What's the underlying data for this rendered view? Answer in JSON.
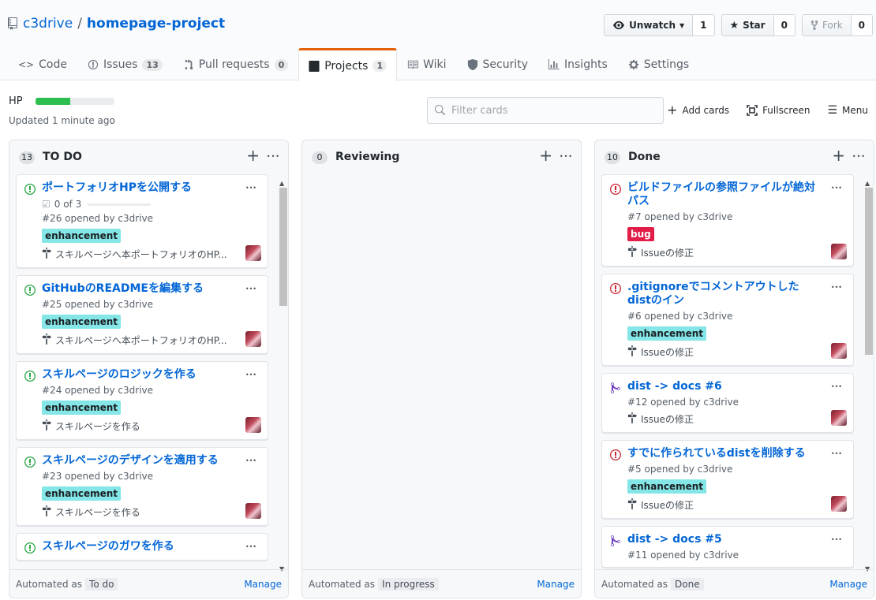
{
  "repo": {
    "owner": "c3drive",
    "separator": "/",
    "name": "homepage-project"
  },
  "actions": {
    "watch": {
      "label": "Unwatch",
      "count": "1"
    },
    "star": {
      "label": "Star",
      "count": "0"
    },
    "fork": {
      "label": "Fork",
      "count": "0"
    }
  },
  "tabs": [
    {
      "label": "Code",
      "counter": "",
      "icon": "code-icon"
    },
    {
      "label": "Issues",
      "counter": "13",
      "icon": "issue-icon"
    },
    {
      "label": "Pull requests",
      "counter": "0",
      "icon": "pull-request-icon"
    },
    {
      "label": "Projects",
      "counter": "1",
      "icon": "project-icon",
      "selected": true
    },
    {
      "label": "Wiki",
      "counter": "",
      "icon": "book-icon"
    },
    {
      "label": "Security",
      "counter": "",
      "icon": "shield-icon"
    },
    {
      "label": "Insights",
      "counter": "",
      "icon": "graph-icon"
    },
    {
      "label": "Settings",
      "counter": "",
      "icon": "gear-icon"
    }
  ],
  "project": {
    "name": "HP",
    "progress": 0.44,
    "updated": "Updated 1 minute ago",
    "filter_placeholder": "Filter cards",
    "add_cards": "Add cards",
    "fullscreen": "Fullscreen",
    "menu": "Menu"
  },
  "columns": [
    {
      "name": "TO DO",
      "count": "13",
      "automated_prefix": "Automated as",
      "automated_as": "To do",
      "manage": "Manage",
      "cards": [
        {
          "type": "issue-open",
          "title": "ポートフォリオHPを公開する",
          "checklist": "0 of 3",
          "meta": "#26 opened by c3drive",
          "label": "enhancement",
          "milestone": "スキルページへ本ポートフォリオのHP..."
        },
        {
          "type": "issue-open",
          "title": "GitHubのREADMEを編集する",
          "meta": "#25 opened by c3drive",
          "label": "enhancement",
          "milestone": "スキルページへ本ポートフォリオのHP..."
        },
        {
          "type": "issue-open",
          "title": "スキルページのロジックを作る",
          "meta": "#24 opened by c3drive",
          "label": "enhancement",
          "milestone": "スキルページを作る"
        },
        {
          "type": "issue-open",
          "title": "スキルページのデザインを適用する",
          "meta": "#23 opened by c3drive",
          "label": "enhancement",
          "milestone": "スキルページを作る"
        },
        {
          "type": "issue-open",
          "title": "スキルページのガワを作る",
          "meta": "",
          "label": "",
          "milestone": ""
        }
      ]
    },
    {
      "name": "Reviewing",
      "count": "0",
      "automated_prefix": "Automated as",
      "automated_as": "In progress",
      "manage": "Manage",
      "cards": []
    },
    {
      "name": "Done",
      "count": "10",
      "automated_prefix": "Automated as",
      "automated_as": "Done",
      "manage": "Manage",
      "cards": [
        {
          "type": "issue-closed",
          "title": "ビルドファイルの参照ファイルが絶対パス",
          "meta": "#7 opened by c3drive",
          "label": "bug",
          "milestone": "Issueの修正"
        },
        {
          "type": "issue-closed",
          "title": ".gitignoreでコメントアウトしたdistのイン",
          "meta": "#6 opened by c3drive",
          "label": "enhancement",
          "milestone": "Issueの修正"
        },
        {
          "type": "pr-merged",
          "title": "dist -> docs #6",
          "meta": "#12 opened by c3drive",
          "label": "",
          "milestone": "Issueの修正"
        },
        {
          "type": "issue-closed",
          "title": "すでに作られているdistを削除する",
          "meta": "#5 opened by c3drive",
          "label": "enhancement",
          "milestone": "Issueの修正"
        },
        {
          "type": "pr-merged",
          "title": "dist -> docs #5",
          "meta": "#11 opened by c3drive",
          "label": "",
          "milestone": ""
        }
      ]
    }
  ],
  "colors": {
    "link": "#0366d6",
    "open": "#28a745",
    "closed": "#cb2431",
    "merged": "#6f42c1",
    "enhancement_bg": "#84e6e6",
    "bug_bg": "#e11d48",
    "progress": "#2cbe4e",
    "tab_accent": "#e36209"
  }
}
